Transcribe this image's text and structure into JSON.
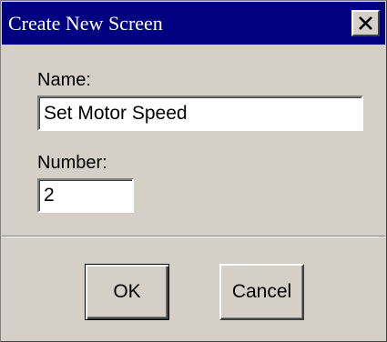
{
  "window": {
    "title": "Create New Screen",
    "close_icon": "close-icon"
  },
  "form": {
    "name_label": "Name:",
    "name_value": "Set Motor Speed",
    "number_label": "Number:",
    "number_value": "2"
  },
  "buttons": {
    "ok_label": "OK",
    "cancel_label": "Cancel"
  },
  "colors": {
    "title_bar": "#000080",
    "dialog_face": "#d4d0c8"
  }
}
